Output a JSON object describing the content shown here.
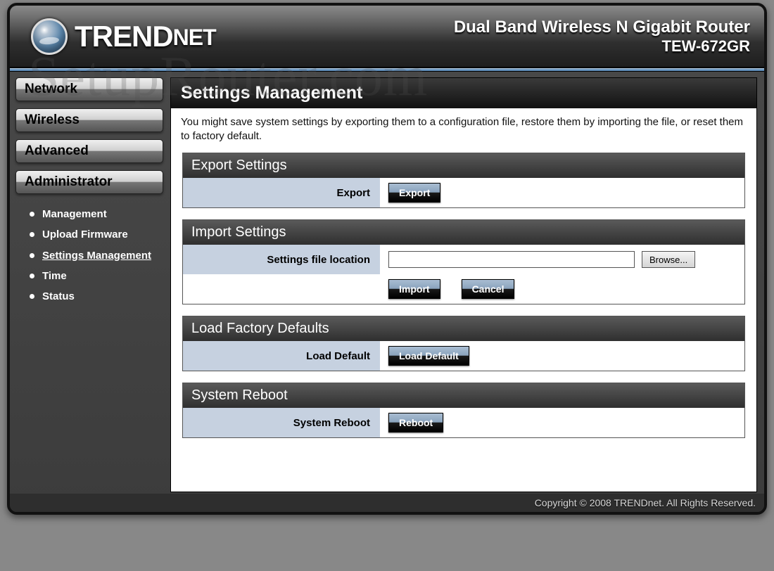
{
  "brand": {
    "main": "TREND",
    "sub": "NET"
  },
  "product": {
    "line1": "Dual Band Wireless N Gigabit Router",
    "line2": "TEW-672GR"
  },
  "watermark": "SetupRouter.com",
  "nav": {
    "items": [
      {
        "label": "Network"
      },
      {
        "label": "Wireless"
      },
      {
        "label": "Advanced"
      },
      {
        "label": "Administrator"
      }
    ],
    "sub": [
      {
        "label": "Management"
      },
      {
        "label": "Upload Firmware"
      },
      {
        "label": "Settings Management",
        "active": true
      },
      {
        "label": "Time"
      },
      {
        "label": "Status"
      }
    ]
  },
  "page": {
    "title": "Settings Management",
    "intro": "You might save system settings by exporting them to a configuration file, restore them by importing the file, or reset them to factory default."
  },
  "sections": {
    "export": {
      "header": "Export Settings",
      "label": "Export",
      "button": "Export"
    },
    "import": {
      "header": "Import Settings",
      "file_label": "Settings file location",
      "file_value": "",
      "browse": "Browse...",
      "import_btn": "Import",
      "cancel_btn": "Cancel"
    },
    "defaults": {
      "header": "Load Factory Defaults",
      "label": "Load Default",
      "button": "Load Default"
    },
    "reboot": {
      "header": "System Reboot",
      "label": "System Reboot",
      "button": "Reboot"
    }
  },
  "footer": "Copyright © 2008 TRENDnet. All Rights Reserved."
}
